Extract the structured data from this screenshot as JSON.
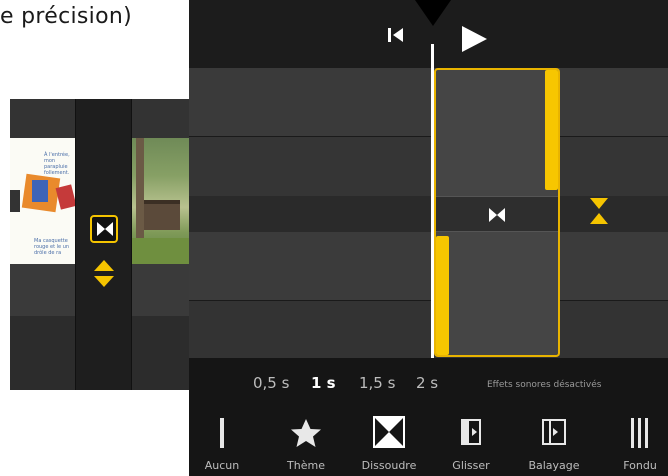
{
  "caption": "e précision)",
  "left_panel": {
    "doc_text_1": "À l'entrée, mon parapluie follement.",
    "doc_text_2": "Ma casquette rouge et le un drôle de ra"
  },
  "durations": [
    "0,5 s",
    "1 s",
    "1,5 s",
    "2 s"
  ],
  "selected_duration": "1 s",
  "sound_effects_label": "Effets sonores désactivés",
  "transitions": [
    {
      "label": "Aucun",
      "icon": "bar-icon"
    },
    {
      "label": "Thème",
      "icon": "star-icon"
    },
    {
      "label": "Dissoudre",
      "icon": "dissolve-icon"
    },
    {
      "label": "Glisser",
      "icon": "slide-icon"
    },
    {
      "label": "Balayage",
      "icon": "wipe-icon"
    },
    {
      "label": "Fondu",
      "icon": "fade-icon"
    }
  ],
  "colors": {
    "accent": "#f7c600",
    "background": "#1f1f1f"
  }
}
